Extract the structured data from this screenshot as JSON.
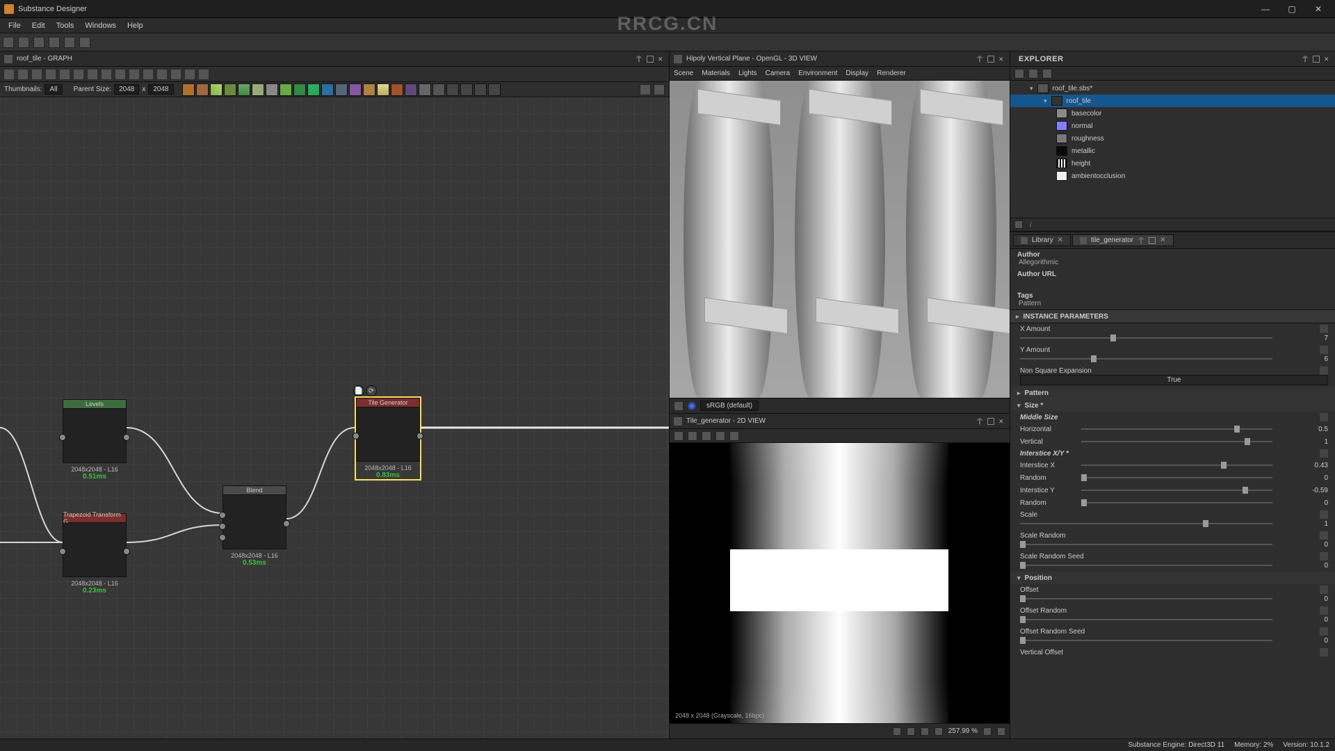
{
  "app": {
    "title": "Substance Designer"
  },
  "menu": [
    "File",
    "Edit",
    "Tools",
    "Windows",
    "Help"
  ],
  "win_buttons": {
    "min": "—",
    "max": "▢",
    "close": "✕"
  },
  "graph": {
    "tab": "roof_tile - GRAPH",
    "lib_label": "Thumbnails:",
    "lib_value": "All",
    "parent_label": "Parent Size:",
    "parent_w": "2048",
    "parent_h": "2048",
    "nodes": {
      "levels": {
        "title": "Levels",
        "info": "2048x2048 - L16",
        "time": "0.51ms"
      },
      "trapezoid": {
        "title": "Trapezoid Transform G...",
        "info": "2048x2048 - L16",
        "time": "0.23ms"
      },
      "blend": {
        "title": "Blend",
        "info": "2048x2048 - L16",
        "time": "0.53ms"
      },
      "tilegen": {
        "title": "Tile Generator",
        "info": "2048x2048 - L16",
        "time": "0.83ms"
      }
    }
  },
  "view3d": {
    "title": "Hipoly Vertical Plane - OpenGL - 3D VIEW",
    "menu": [
      "Scene",
      "Materials",
      "Lights",
      "Camera",
      "Environment",
      "Display",
      "Renderer"
    ],
    "colorspace": "sRGB (default)"
  },
  "view2d": {
    "title": "Tile_generator - 2D VIEW",
    "info": "2048 x 2048 (Grayscale, 16bpc)",
    "zoom": "257.99 %"
  },
  "explorer": {
    "title": "EXPLORER",
    "root": "roof_tile.sbs*",
    "graph": "roof_tile",
    "outputs": [
      "basecolor",
      "normal",
      "roughness",
      "metallic",
      "height",
      "ambientocclusion"
    ]
  },
  "props": {
    "tab_library": "Library",
    "tab_node": "tile_generator",
    "author_label": "Author",
    "author": "Allegorithmic",
    "author_url_label": "Author URL",
    "tags_label": "Tags",
    "tags": "Pattern",
    "instance_header": "INSTANCE PARAMETERS",
    "params": {
      "x_amount": {
        "label": "X Amount",
        "value": "7",
        "knob": "33%"
      },
      "y_amount": {
        "label": "Y Amount",
        "value": "6",
        "knob": "26%"
      },
      "non_square": {
        "label": "Non Square Expansion",
        "value": "True"
      },
      "pattern_hdr": "Pattern",
      "size_hdr": "Size *",
      "middle_size": {
        "label": "Middle Size"
      },
      "horizontal": {
        "label": "Horizontal",
        "value": "0.5",
        "knob": "72%"
      },
      "vertical": {
        "label": "Vertical",
        "value": "1",
        "knob": "77%"
      },
      "interstice_hdr": "Interstice X/Y *",
      "interstice_x": {
        "label": "Interstice X",
        "value": "0.43",
        "knob": "66%"
      },
      "random1": {
        "label": "Random",
        "value": "0",
        "knob": "0%"
      },
      "interstice_y": {
        "label": "Interstice Y",
        "value": "-0.59",
        "knob": "76%"
      },
      "random2": {
        "label": "Random",
        "value": "0",
        "knob": "0%"
      },
      "scale": {
        "label": "Scale",
        "value": "1",
        "knob": "67%"
      },
      "scale_random": {
        "label": "Scale Random",
        "value": "0",
        "knob": "0%"
      },
      "scale_random_seed": {
        "label": "Scale Random Seed",
        "value": "0",
        "knob": "0%"
      },
      "position_hdr": "Position",
      "offset": {
        "label": "Offset",
        "value": "0",
        "knob": "0%"
      },
      "offset_random": {
        "label": "Offset Random",
        "value": "0",
        "knob": "0%"
      },
      "offset_random_seed": {
        "label": "Offset Random Seed",
        "value": "0",
        "knob": "0%"
      },
      "vertical_offset": {
        "label": "Vertical Offset"
      }
    }
  },
  "status": {
    "engine": "Substance Engine: Direct3D 11",
    "memory": "Memory: 2%",
    "version": "Version: 10.1.2"
  },
  "watermark": "RRCG.CN"
}
